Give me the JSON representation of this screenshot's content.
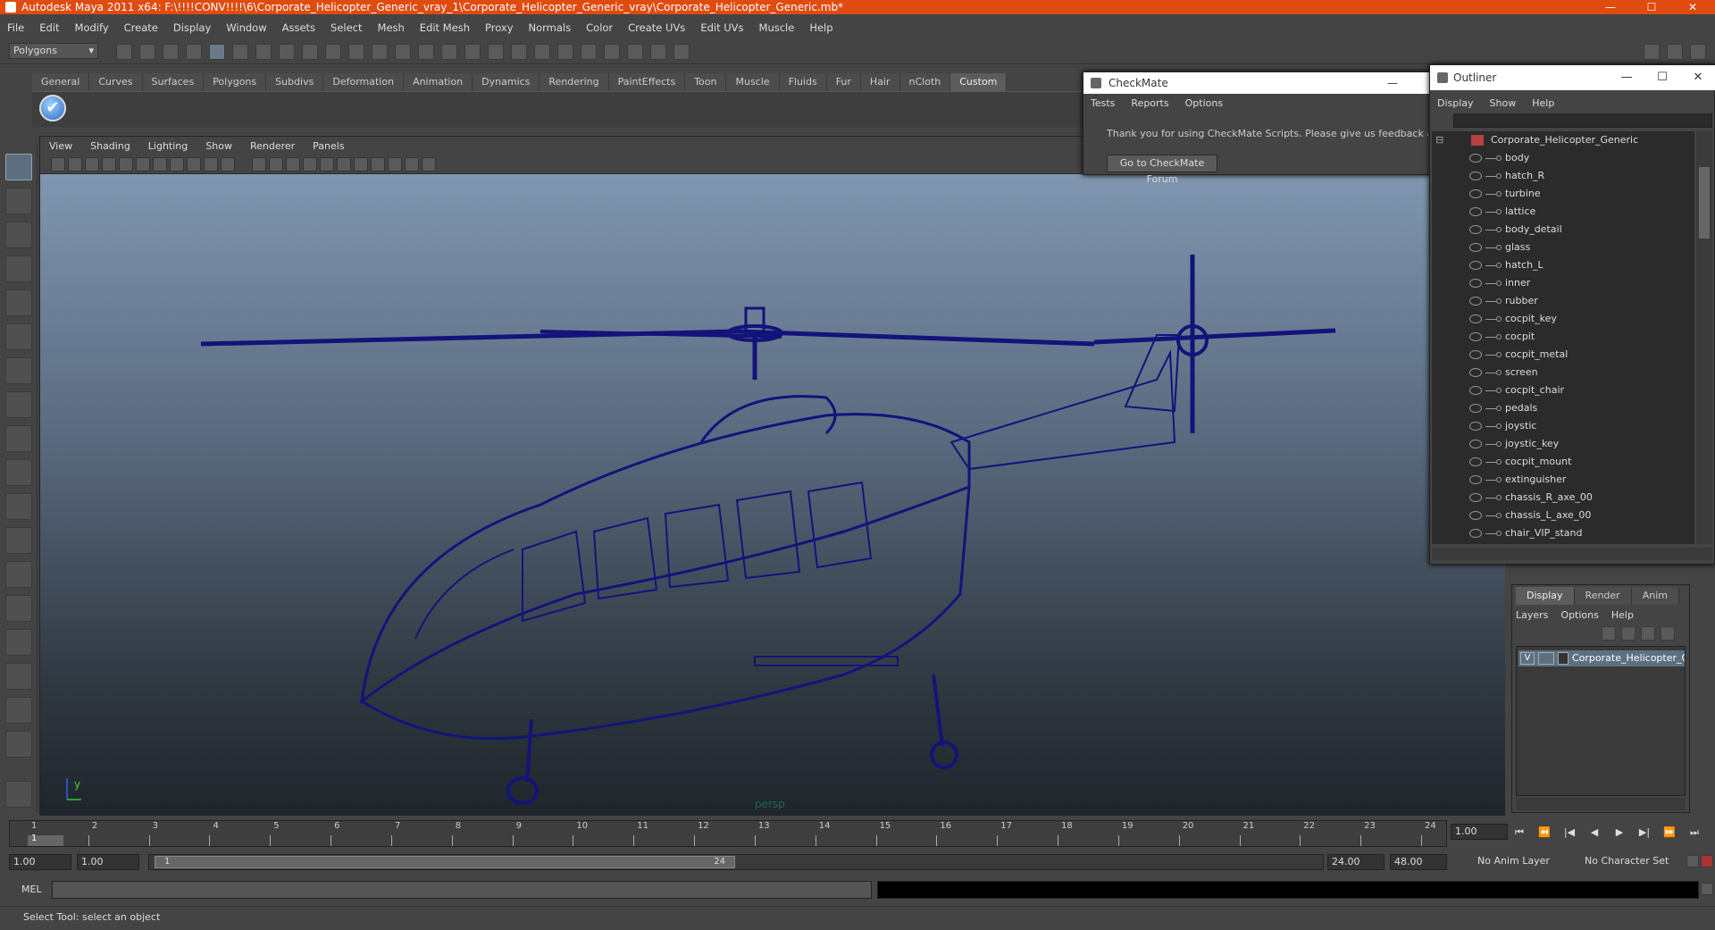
{
  "window": {
    "title": "Autodesk Maya 2011 x64: F:\\!!!!CONV!!!!\\6\\Corporate_Helicopter_Generic_vray_1\\Corporate_Helicopter_Generic_vray\\Corporate_Helicopter_Generic.mb*",
    "controls": {
      "minimize": "—",
      "maximize": "☐",
      "close": "✕"
    }
  },
  "menubar": [
    "File",
    "Edit",
    "Modify",
    "Create",
    "Display",
    "Window",
    "Assets",
    "Select",
    "Mesh",
    "Edit Mesh",
    "Proxy",
    "Normals",
    "Color",
    "Create UVs",
    "Edit UVs",
    "Muscle",
    "Help"
  ],
  "statusline": {
    "mode": "Polygons"
  },
  "shelf": {
    "tabs": [
      "General",
      "Curves",
      "Surfaces",
      "Polygons",
      "Subdivs",
      "Deformation",
      "Animation",
      "Dynamics",
      "Rendering",
      "PaintEffects",
      "Toon",
      "Muscle",
      "Fluids",
      "Fur",
      "Hair",
      "nCloth",
      "Custom"
    ],
    "active": "Custom",
    "checkmark_icon": "✔"
  },
  "viewport": {
    "menu": [
      "View",
      "Shading",
      "Lighting",
      "Show",
      "Renderer",
      "Panels"
    ],
    "camera": "persp",
    "axis_y": "y",
    "wire_color": "#13137a"
  },
  "checkmate": {
    "title": "CheckMate",
    "menu": [
      "Tests",
      "Reports",
      "Options"
    ],
    "message": "Thank you for using CheckMate Scripts. Please give us feedback at the Che",
    "button": "Go to CheckMate Forum"
  },
  "outliner": {
    "title": "Outliner",
    "menu": [
      "Display",
      "Show",
      "Help"
    ],
    "root": "Corporate_Helicopter_Generic",
    "items": [
      "body",
      "hatch_R",
      "turbine",
      "lattice",
      "body_detail",
      "glass",
      "hatch_L",
      "inner",
      "rubber",
      "cocpit_key",
      "cocpit",
      "cocpit_metal",
      "screen",
      "cocpit_chair",
      "pedals",
      "joystic",
      "joystic_key",
      "cocpit_mount",
      "extinguisher",
      "chassis_R_axe_00",
      "chassis_L_axe_00",
      "chair_VIP_stand"
    ]
  },
  "layers": {
    "tabs": [
      "Display",
      "Render",
      "Anim"
    ],
    "active": "Display",
    "menu": [
      "Layers",
      "Options",
      "Help"
    ],
    "layer": {
      "visible": "V",
      "name": "Corporate_Helicopter_Ge"
    }
  },
  "timeslider": {
    "ticks": [
      "1",
      "2",
      "3",
      "4",
      "5",
      "6",
      "7",
      "8",
      "9",
      "10",
      "11",
      "12",
      "13",
      "14",
      "15",
      "16",
      "17",
      "18",
      "19",
      "20",
      "21",
      "22",
      "23",
      "24"
    ],
    "current": "1",
    "current_frame": "1.00"
  },
  "playback": [
    "⏮",
    "⏪",
    "|◀",
    "◀",
    "▶",
    "▶|",
    "⏩",
    "⏭"
  ],
  "range": {
    "start": "1.00",
    "anim_start": "1.00",
    "thumb_start": "1",
    "thumb_end": "24",
    "anim_end": "24.00",
    "end": "48.00",
    "anim_layer": "No Anim Layer",
    "character_set": "No Character Set"
  },
  "commandline": {
    "label": "MEL"
  },
  "helpline": "Select Tool: select an object"
}
